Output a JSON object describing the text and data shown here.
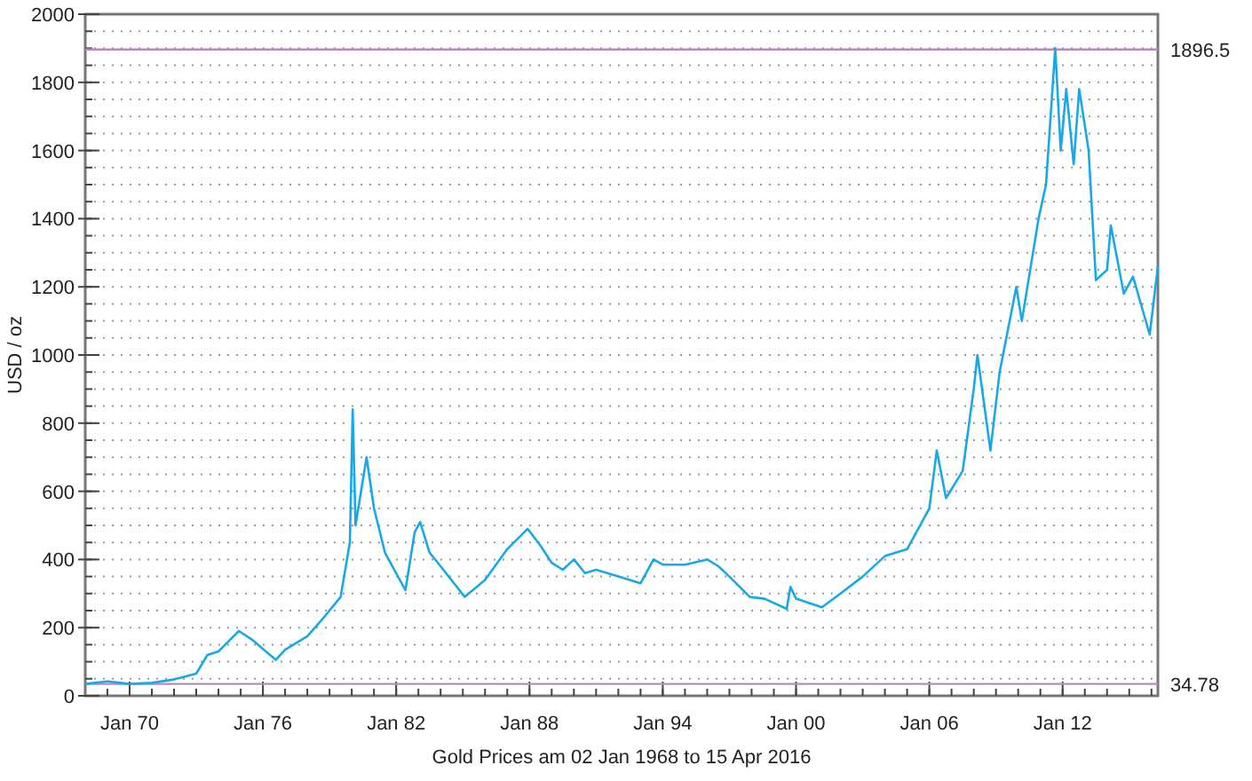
{
  "chart_data": {
    "type": "line",
    "title": "Gold Prices am 02 Jan 1968 to 15 Apr 2016",
    "ylabel": "USD / oz",
    "x": [
      "1968-01-02",
      "1969-01-01",
      "1970-01-01",
      "1971-01-01",
      "1972-01-01",
      "1973-01-01",
      "1973-07-01",
      "1974-01-01",
      "1974-12-01",
      "1975-07-01",
      "1976-08-01",
      "1977-01-01",
      "1978-01-01",
      "1978-10-01",
      "1979-07-01",
      "1979-12-01",
      "1980-01-15",
      "1980-03-01",
      "1980-09-01",
      "1981-01-01",
      "1981-07-01",
      "1982-06-01",
      "1982-11-01",
      "1983-02-01",
      "1983-07-01",
      "1984-01-01",
      "1985-02-01",
      "1986-01-01",
      "1987-01-01",
      "1987-12-01",
      "1988-07-01",
      "1989-01-01",
      "1989-07-01",
      "1990-01-01",
      "1990-07-01",
      "1991-01-01",
      "1992-01-01",
      "1993-01-01",
      "1993-08-01",
      "1994-01-01",
      "1995-01-01",
      "1996-01-01",
      "1996-07-01",
      "1997-01-01",
      "1997-12-01",
      "1998-08-01",
      "1999-08-01",
      "1999-10-01",
      "2000-01-01",
      "2001-03-01",
      "2002-01-01",
      "2003-01-01",
      "2004-01-01",
      "2005-01-01",
      "2006-01-01",
      "2006-05-01",
      "2006-10-01",
      "2007-07-01",
      "2008-01-01",
      "2008-03-01",
      "2008-10-01",
      "2009-03-01",
      "2009-12-01",
      "2010-03-01",
      "2010-12-01",
      "2011-04-01",
      "2011-09-01",
      "2011-12-01",
      "2012-03-01",
      "2012-07-01",
      "2012-10-01",
      "2013-03-01",
      "2013-07-01",
      "2014-01-01",
      "2014-03-01",
      "2014-10-01",
      "2015-03-01",
      "2015-12-01",
      "2016-04-15"
    ],
    "series": [
      {
        "color": "#18a8e8",
        "values": [
          35,
          42,
          35,
          38,
          48,
          65,
          120,
          130,
          190,
          165,
          105,
          135,
          175,
          230,
          290,
          450,
          840,
          500,
          700,
          550,
          420,
          310,
          480,
          510,
          420,
          380,
          290,
          340,
          430,
          490,
          440,
          390,
          370,
          400,
          360,
          370,
          350,
          330,
          400,
          385,
          385,
          400,
          380,
          350,
          290,
          285,
          255,
          320,
          285,
          260,
          300,
          350,
          410,
          430,
          550,
          720,
          580,
          660,
          900,
          1000,
          720,
          950,
          1200,
          1100,
          1400,
          1500,
          1900,
          1600,
          1780,
          1560,
          1780,
          1600,
          1220,
          1250,
          1380,
          1180,
          1230,
          1060,
          1260
        ]
      }
    ],
    "xlim": [
      "1968-01-02",
      "2016-04-15"
    ],
    "ylim": [
      0,
      2000
    ],
    "xticks": [
      {
        "value": "1970-01-01",
        "label": "Jan 70"
      },
      {
        "value": "1976-01-01",
        "label": "Jan 76"
      },
      {
        "value": "1982-01-01",
        "label": "Jan 82"
      },
      {
        "value": "1988-01-01",
        "label": "Jan 88"
      },
      {
        "value": "1994-01-01",
        "label": "Jan 94"
      },
      {
        "value": "2000-01-01",
        "label": "Jan 00"
      },
      {
        "value": "2006-01-01",
        "label": "Jan 06"
      },
      {
        "value": "2012-01-01",
        "label": "Jan 12"
      }
    ],
    "yticks": [
      0,
      200,
      400,
      600,
      800,
      1000,
      1200,
      1400,
      1600,
      1800,
      2000
    ],
    "grid": true,
    "ref_lines": [
      {
        "axis": "y",
        "value": 1896.5,
        "label": "1896.5",
        "color": "#b888c0"
      },
      {
        "axis": "y",
        "value": 34.78,
        "label": "34.78",
        "color": "#b888c0"
      }
    ]
  }
}
